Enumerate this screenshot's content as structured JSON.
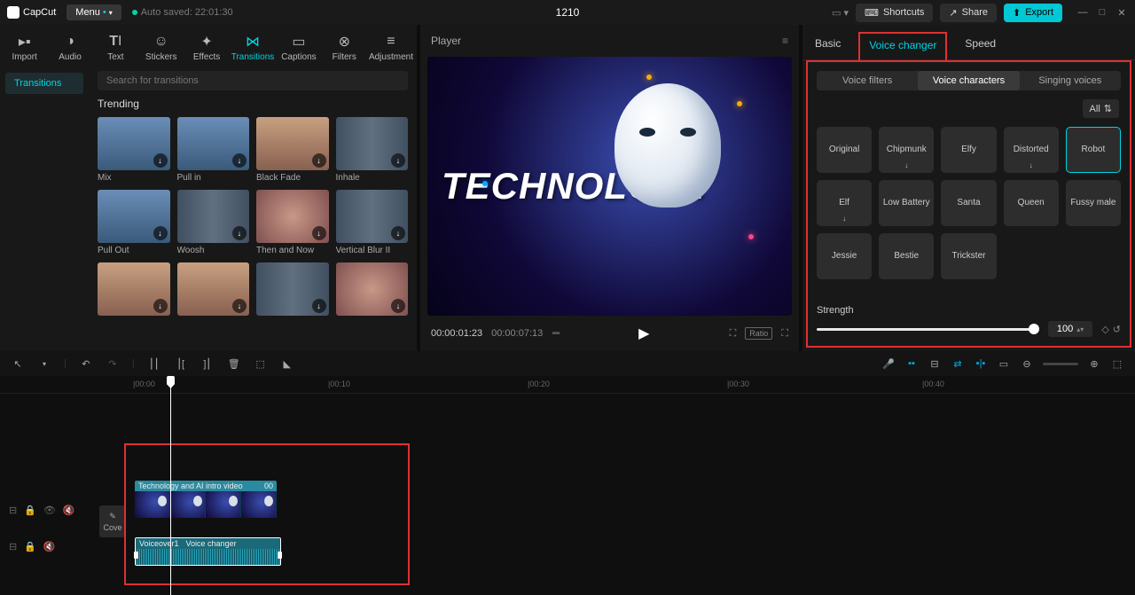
{
  "title": {
    "app": "CapCut",
    "menu": "Menu",
    "autosave": "Auto saved: 22:01:30",
    "project": "1210"
  },
  "topbar": {
    "shortcuts": "Shortcuts",
    "share": "Share",
    "export": "Export"
  },
  "toolTabs": [
    "Import",
    "Audio",
    "Text",
    "Stickers",
    "Effects",
    "Transitions",
    "Captions",
    "Filters",
    "Adjustment"
  ],
  "sideNav": {
    "transitions": "Transitions"
  },
  "search": {
    "placeholder": "Search for transitions"
  },
  "trending": {
    "title": "Trending",
    "items": [
      "Mix",
      "Pull in",
      "Black Fade",
      "Inhale",
      "Pull Out",
      "Woosh",
      "Then and Now",
      "Vertical Blur II",
      "",
      "",
      "",
      ""
    ]
  },
  "player": {
    "label": "Player",
    "overlayText": "TECHNOLOGY",
    "time_current": "00:00:01:23",
    "time_total": "00:00:07:13",
    "ratio": "Ratio"
  },
  "rightTabs": {
    "basic": "Basic",
    "voice": "Voice changer",
    "speed": "Speed"
  },
  "subTabs": {
    "filters": "Voice filters",
    "chars": "Voice characters",
    "singing": "Singing voices"
  },
  "filterAll": "All",
  "voices": [
    "Original",
    "Chipmunk",
    "Elfy",
    "Distorted",
    "Robot",
    "Elf",
    "Low Battery",
    "Santa",
    "Queen",
    "Fussy male",
    "Jessie",
    "Bestie",
    "Trickster"
  ],
  "strength": {
    "label": "Strength",
    "value": "100"
  },
  "ruler": {
    "t0": "|00:00",
    "t10": "|00:10",
    "t20": "|00:20",
    "t30": "|00:30",
    "t40": "|00:40"
  },
  "coverBtn": "Cove",
  "videoClip": {
    "label": "Technology and AI intro video",
    "dur": "00"
  },
  "audioClip": {
    "name": "Voiceover1",
    "effect": "Voice changer"
  }
}
